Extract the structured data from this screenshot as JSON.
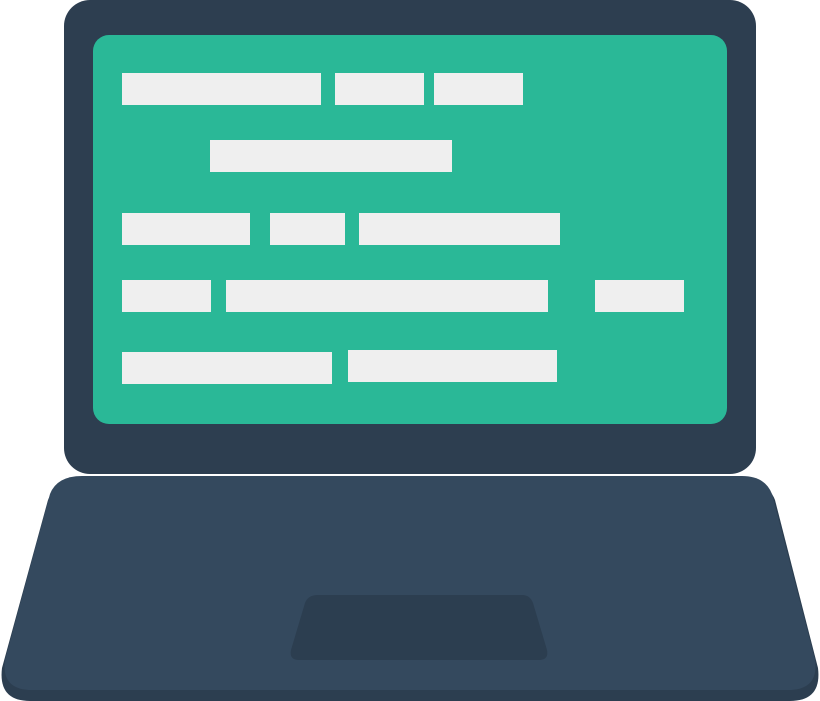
{
  "colors": {
    "bezel": "#2d3e50",
    "screen": "#2ab897",
    "code_line": "#efefef",
    "base": "#34495e",
    "base_edge": "#2c3e50",
    "hinge": "#2a3a4b",
    "trackpad": "#2c3e50"
  },
  "icon": "laptop-icon",
  "code_rows": [
    {
      "segments": 3
    },
    {
      "segments": 1
    },
    {
      "segments": 3
    },
    {
      "segments": 3
    },
    {
      "segments": 2
    }
  ]
}
